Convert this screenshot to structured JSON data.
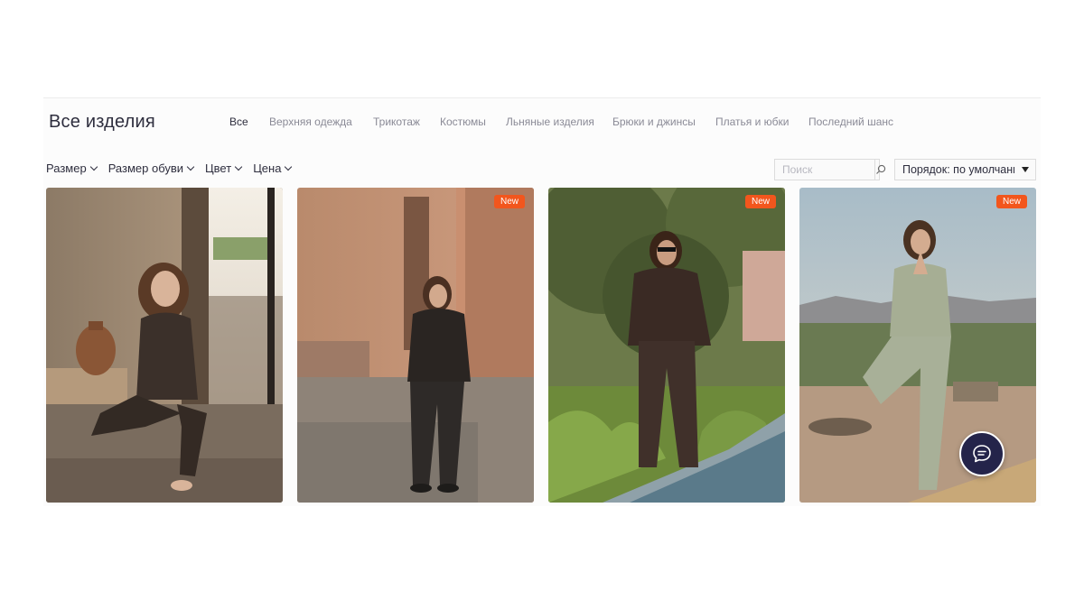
{
  "header": {
    "title": "Все изделия"
  },
  "categories": [
    {
      "label": "Все",
      "active": true
    },
    {
      "label": "Верхняя одежда",
      "active": false
    },
    {
      "label": "Трикотаж",
      "active": false
    },
    {
      "label": "Костюмы",
      "active": false
    },
    {
      "label": "Льняные изделия",
      "active": false
    },
    {
      "label": "Брюки и джинсы",
      "active": false
    },
    {
      "label": "Платья и юбки",
      "active": false
    },
    {
      "label": "Последний шанс",
      "active": false
    }
  ],
  "filters": [
    {
      "label": "Размер"
    },
    {
      "label": "Размер обуви"
    },
    {
      "label": "Цвет"
    },
    {
      "label": "Цена"
    }
  ],
  "search": {
    "placeholder": "Поиск",
    "icon": "search-icon"
  },
  "sort": {
    "label": "Порядок: по умолчанию"
  },
  "products": [
    {
      "badge": ""
    },
    {
      "badge": "New"
    },
    {
      "badge": "New"
    },
    {
      "badge": "New"
    }
  ],
  "chat": {
    "icon": "chat-bubble-icon"
  },
  "colors": {
    "badge": "#f2561d",
    "chat": "#24244a",
    "text": "#2e2e3e",
    "muted": "#8a8a96"
  }
}
